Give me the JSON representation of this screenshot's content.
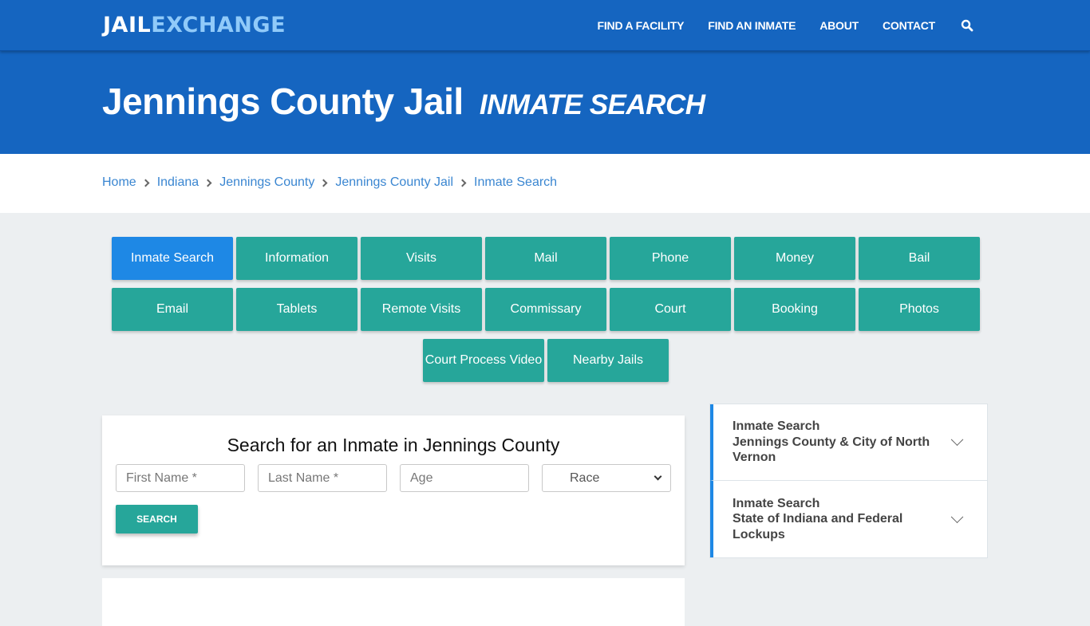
{
  "header": {
    "logo_part1": "JAIL",
    "logo_part2": "EXCHANGE",
    "nav": [
      "FIND A FACILITY",
      "FIND AN INMATE",
      "ABOUT",
      "CONTACT"
    ],
    "search_icon": "search-icon"
  },
  "hero": {
    "title": "Jennings County Jail",
    "subtitle": "INMATE SEARCH"
  },
  "breadcrumb": [
    "Home",
    "Indiana",
    "Jennings County",
    "Jennings County Jail",
    "Inmate Search"
  ],
  "tabs": {
    "row1": [
      "Inmate Search",
      "Information",
      "Visits",
      "Mail",
      "Phone",
      "Money",
      "Bail"
    ],
    "row2": [
      "Email",
      "Tablets",
      "Remote Visits",
      "Commissary",
      "Court",
      "Booking",
      "Photos"
    ],
    "row3": [
      "Court Process Video",
      "Nearby Jails"
    ],
    "active": "Inmate Search"
  },
  "search_form": {
    "title": "Search for an Inmate in Jennings County",
    "first_name_placeholder": "First Name *",
    "last_name_placeholder": "Last Name *",
    "age_placeholder": "Age",
    "race_selected": "Race",
    "button": "SEARCH"
  },
  "sidebar": {
    "items": [
      {
        "line1": "Inmate Search",
        "line2": "Jennings County & City of North Vernon"
      },
      {
        "line1": "Inmate Search",
        "line2": "State of Indiana and Federal Lockups"
      }
    ]
  },
  "colors": {
    "brand_blue": "#1565c0",
    "logo_accent": "#90caf9",
    "tab_teal": "#26a69a",
    "tab_active": "#1e88e5",
    "link": "#3a86d1"
  }
}
